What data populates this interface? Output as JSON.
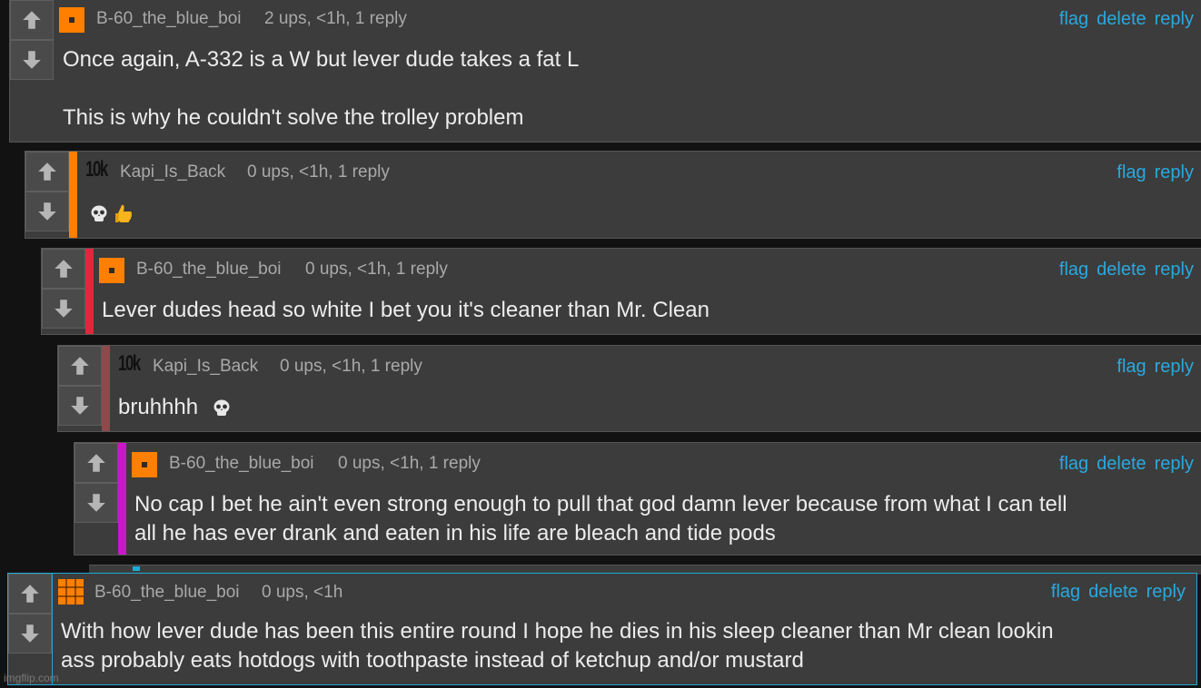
{
  "colors": {
    "link": "#29a9e0",
    "bar_orange": "#ff7f00",
    "bar_red": "#e0283c",
    "bar_brown": "#8c4a4a",
    "bar_magenta": "#c817c8",
    "highlight_border": "#1fa9d6"
  },
  "vote_icons": {
    "up": "arrow-up-icon",
    "down": "arrow-down-icon"
  },
  "comments": [
    {
      "author": "B-60_the_blue_boi",
      "meta": "2 ups, <1h, 1 reply",
      "actions": [
        "flag",
        "delete",
        "reply"
      ],
      "lines": [
        "Once again, A-332 is a W but lever dude takes a fat L",
        "",
        "This is why he couldn't solve the trolley problem"
      ]
    },
    {
      "badge": "10k",
      "author": "Kapi_Is_Back",
      "meta": "0 ups, <1h, 1 reply",
      "actions": [
        "flag",
        "reply"
      ],
      "emojis": [
        "skull-emoji",
        "thumbs-up-emoji"
      ]
    },
    {
      "author": "B-60_the_blue_boi",
      "meta": "0 ups, <1h, 1 reply",
      "actions": [
        "flag",
        "delete",
        "reply"
      ],
      "lines": [
        "Lever dudes head so white I bet you it's cleaner than Mr. Clean"
      ]
    },
    {
      "badge": "10k",
      "author": "Kapi_Is_Back",
      "meta": "0 ups, <1h, 1 reply",
      "actions": [
        "flag",
        "reply"
      ],
      "lines": [
        "bruhhhh"
      ],
      "emojis": [
        "skull-emoji"
      ]
    },
    {
      "author": "B-60_the_blue_boi",
      "meta": "0 ups, <1h, 1 reply",
      "actions": [
        "flag",
        "delete",
        "reply"
      ],
      "lines": [
        "No cap I bet he ain't even strong enough to pull that god damn lever because from what I can tell",
        "all he has ever drank and eaten in his life are bleach and tide pods"
      ]
    },
    {
      "author": "B-60_the_blue_boi",
      "meta": "0 ups, <1h",
      "actions": [
        "flag",
        "delete",
        "reply"
      ],
      "lines": [
        "With how lever dude has been this entire round I hope he dies in his sleep cleaner than Mr clean lookin",
        "ass probably eats hotdogs with toothpaste instead of ketchup and/or mustard"
      ]
    }
  ],
  "watermark": "imgflip.com"
}
